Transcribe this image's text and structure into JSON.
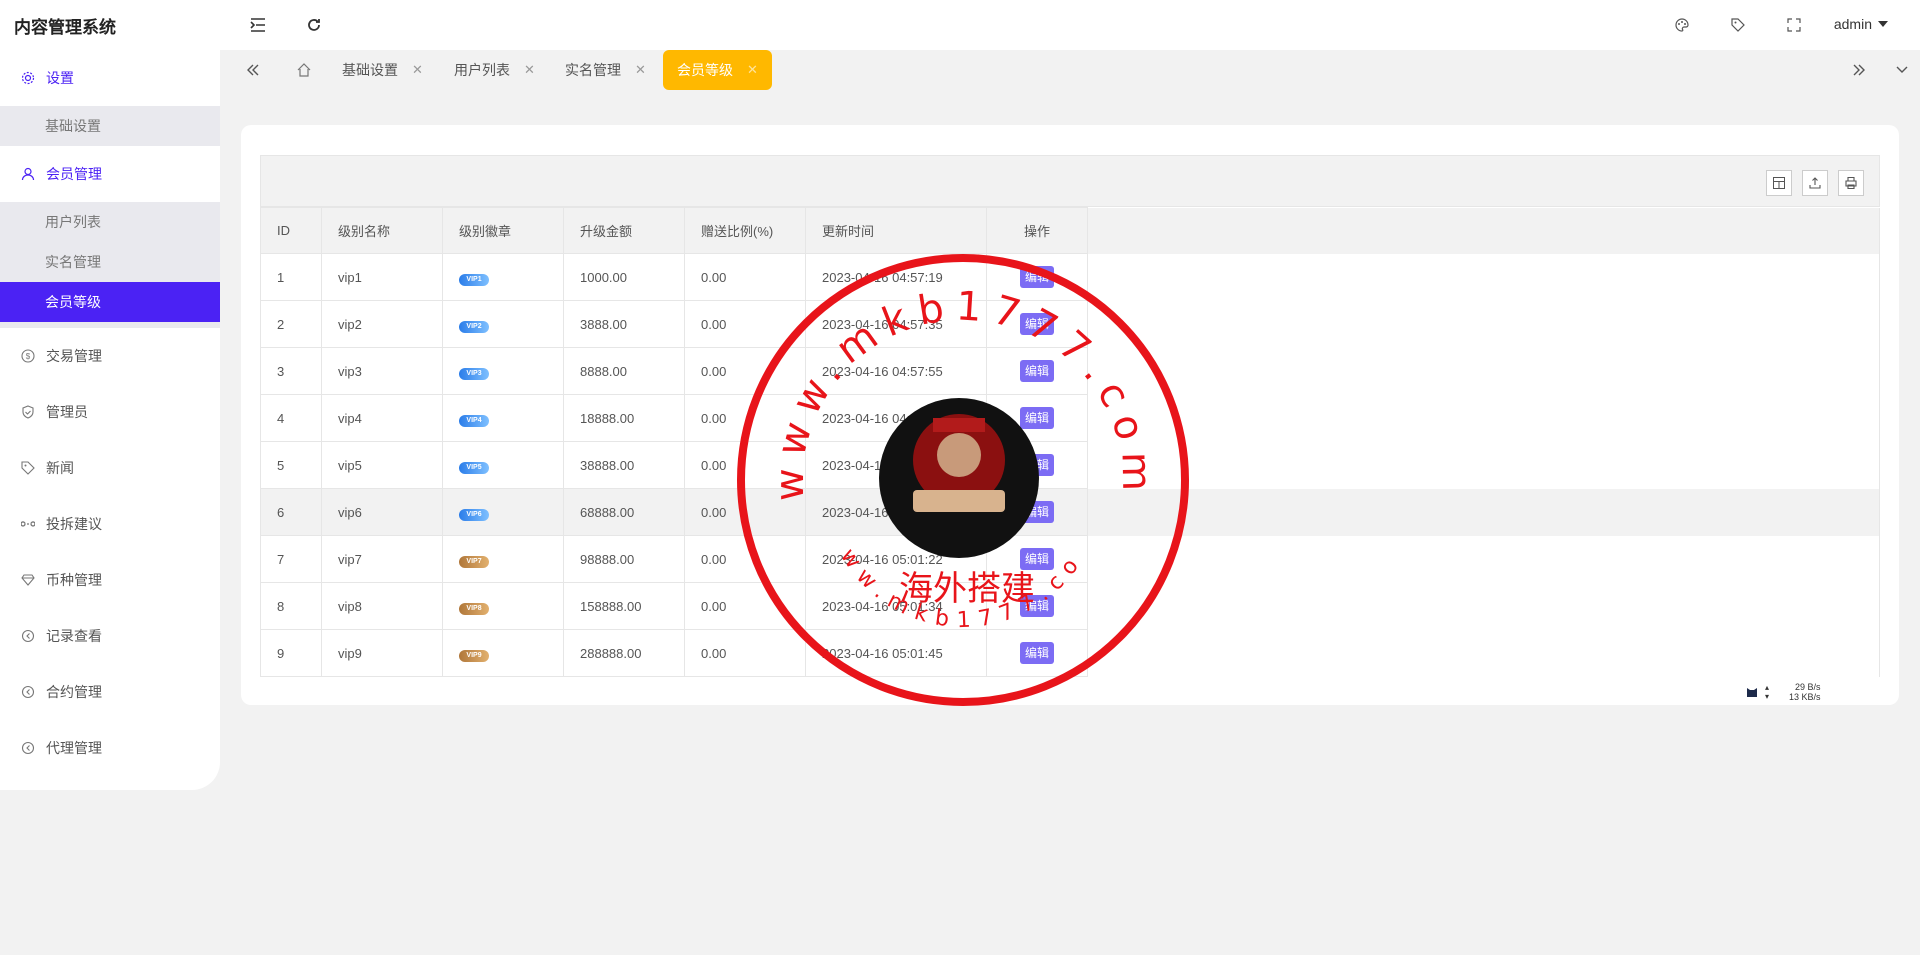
{
  "app_title": "内容管理系统",
  "header": {
    "user": "admin",
    "icons": [
      "menu-fold-icon",
      "refresh-icon",
      "theme-icon",
      "tag-icon",
      "fullscreen-icon"
    ]
  },
  "sidebar": {
    "items": [
      {
        "label": "设置",
        "icon": "gear-icon",
        "active": true,
        "children": [
          {
            "label": "基础设置",
            "selected": false
          }
        ]
      },
      {
        "label": "会员管理",
        "icon": "user-icon",
        "active": true,
        "children": [
          {
            "label": "用户列表",
            "selected": false
          },
          {
            "label": "实名管理",
            "selected": false
          },
          {
            "label": "会员等级",
            "selected": true
          }
        ]
      },
      {
        "label": "交易管理",
        "icon": "dollar-icon"
      },
      {
        "label": "管理员",
        "icon": "shield-icon"
      },
      {
        "label": "新闻",
        "icon": "tag-icon"
      },
      {
        "label": "投拆建议",
        "icon": "link-icon"
      },
      {
        "label": "币种管理",
        "icon": "diamond-icon"
      },
      {
        "label": "记录查看",
        "icon": "circle-arrow-icon"
      },
      {
        "label": "合约管理",
        "icon": "circle-arrow-icon"
      },
      {
        "label": "代理管理",
        "icon": "circle-arrow-icon"
      }
    ]
  },
  "tabs": [
    {
      "label": "基础设置",
      "active": false
    },
    {
      "label": "用户列表",
      "active": false
    },
    {
      "label": "实名管理",
      "active": false
    },
    {
      "label": "会员等级",
      "active": true
    }
  ],
  "table": {
    "columns": [
      "ID",
      "级别名称",
      "级别徽章",
      "升级金额",
      "赠送比例(%)",
      "更新时间",
      "操作"
    ],
    "edit_label": "编辑",
    "rows": [
      {
        "id": "1",
        "name": "vip1",
        "badge": "VIP1",
        "badge_color": "blue",
        "amount": "1000.00",
        "ratio": "0.00",
        "time": "2023-04-16 04:57:19"
      },
      {
        "id": "2",
        "name": "vip2",
        "badge": "VIP2",
        "badge_color": "blue",
        "amount": "3888.00",
        "ratio": "0.00",
        "time": "2023-04-16 04:57:35"
      },
      {
        "id": "3",
        "name": "vip3",
        "badge": "VIP3",
        "badge_color": "blue",
        "amount": "8888.00",
        "ratio": "0.00",
        "time": "2023-04-16 04:57:55"
      },
      {
        "id": "4",
        "name": "vip4",
        "badge": "VIP4",
        "badge_color": "blue",
        "amount": "18888.00",
        "ratio": "0.00",
        "time": "2023-04-16 04:5"
      },
      {
        "id": "5",
        "name": "vip5",
        "badge": "VIP5",
        "badge_color": "blue",
        "amount": "38888.00",
        "ratio": "0.00",
        "time": "2023-04-1"
      },
      {
        "id": "6",
        "name": "vip6",
        "badge": "VIP6",
        "badge_color": "blue",
        "amount": "68888.00",
        "ratio": "0.00",
        "time": "2023-04-16"
      },
      {
        "id": "7",
        "name": "vip7",
        "badge": "VIP7",
        "badge_color": "gold",
        "amount": "98888.00",
        "ratio": "0.00",
        "time": "2023-04-16 05:01:22"
      },
      {
        "id": "8",
        "name": "vip8",
        "badge": "VIP8",
        "badge_color": "gold",
        "amount": "158888.00",
        "ratio": "0.00",
        "time": "2023-04-16 05:01:34"
      },
      {
        "id": "9",
        "name": "vip9",
        "badge": "VIP9",
        "badge_color": "gold",
        "amount": "288888.00",
        "ratio": "0.00",
        "time": "2023-04-16 05:01:45"
      }
    ]
  },
  "net_speed": {
    "up": "29 B/s",
    "down": "13 KB/s"
  },
  "watermark": {
    "url_top": "www.mkb1777.com",
    "center": "海外搭建",
    "url_bottom": "www.mkb1777.com",
    "color": "#e8141a"
  }
}
